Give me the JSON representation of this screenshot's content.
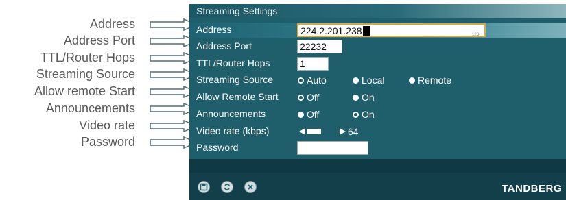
{
  "callouts": [
    "Address",
    "Address Port",
    "TTL/Router Hops",
    "Streaming Source",
    "Allow remote Start",
    "Announcements",
    "Video rate",
    "Password"
  ],
  "panel": {
    "title": "Streaming Settings",
    "accent_color": "#1f5e6b",
    "rows": {
      "address": {
        "label": "Address",
        "value": "224.2.201.238",
        "hint": "123"
      },
      "address_port": {
        "label": "Address Port",
        "value": "22232"
      },
      "ttl": {
        "label": "TTL/Router Hops",
        "value": "1"
      },
      "streaming_source": {
        "label": "Streaming Source",
        "options": [
          "Auto",
          "Local",
          "Remote"
        ],
        "selected": "Auto"
      },
      "allow_remote_start": {
        "label": "Allow Remote Start",
        "options": [
          "Off",
          "On"
        ],
        "selected": "Off"
      },
      "announcements": {
        "label": "Announcements",
        "options": [
          "Off",
          "On"
        ],
        "selected": "On"
      },
      "video_rate": {
        "label": "Video rate (kbps)",
        "value": "64"
      },
      "password": {
        "label": "Password",
        "value": ""
      }
    },
    "footer": {
      "icons": [
        "save-icon",
        "refresh-icon",
        "cancel-icon"
      ],
      "brand": "TANDBERG"
    }
  }
}
